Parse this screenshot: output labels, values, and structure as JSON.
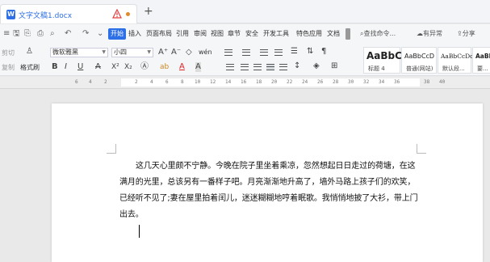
{
  "tab": {
    "title": "文字文稿1.docx",
    "doc_icon": "W",
    "new_tab": "+"
  },
  "menu": {
    "active": "开始",
    "items": [
      "插入",
      "页面布局",
      "引用",
      "审阅",
      "视图",
      "章节",
      "安全",
      "开发工具",
      "特色应用",
      "文档"
    ],
    "search": "查找命令...",
    "right": [
      "有异常",
      "分享"
    ]
  },
  "toolbar": {
    "cut": "剪切",
    "copy": "复制",
    "format_painter": "格式刷",
    "font": "微软雅黑",
    "size": "小四",
    "bold": "B",
    "italic": "I",
    "underline": "U",
    "strike": "A",
    "superscript": "X²",
    "subscript": "X₂",
    "font_color": "A",
    "highlight": "ab",
    "grow_font": "A⁺",
    "shrink_font": "A⁻",
    "clear_format": "◇",
    "phonetic": "wén"
  },
  "styles": [
    {
      "sample": "AaBbC",
      "name": "标题 4"
    },
    {
      "sample": "AaBbCcD",
      "name": "普通(网站)"
    },
    {
      "sample": "AaBbCcDd",
      "name": "默认段..."
    },
    {
      "sample": "AaBb",
      "name": "要..."
    }
  ],
  "ruler": {
    "ticks": [
      "6",
      "4",
      "2",
      "2",
      "4",
      "6",
      "8",
      "10",
      "12",
      "14",
      "16",
      "18",
      "20",
      "22",
      "24",
      "26",
      "28",
      "30",
      "32",
      "34",
      "36",
      "38",
      "40"
    ]
  },
  "document": {
    "paragraph": "这几天心里颇不宁静。今晚在院子里坐着乘凉，忽然想起日日走过的荷塘，在这满月的光里，总该另有一番样子吧。月亮渐渐地升高了，墙外马路上孩子们的欢笑，已经听不见了;妻在屋里拍着闰儿，迷迷糊糊地哼着眠歌。我悄悄地披了大衫，带上门出去。"
  }
}
